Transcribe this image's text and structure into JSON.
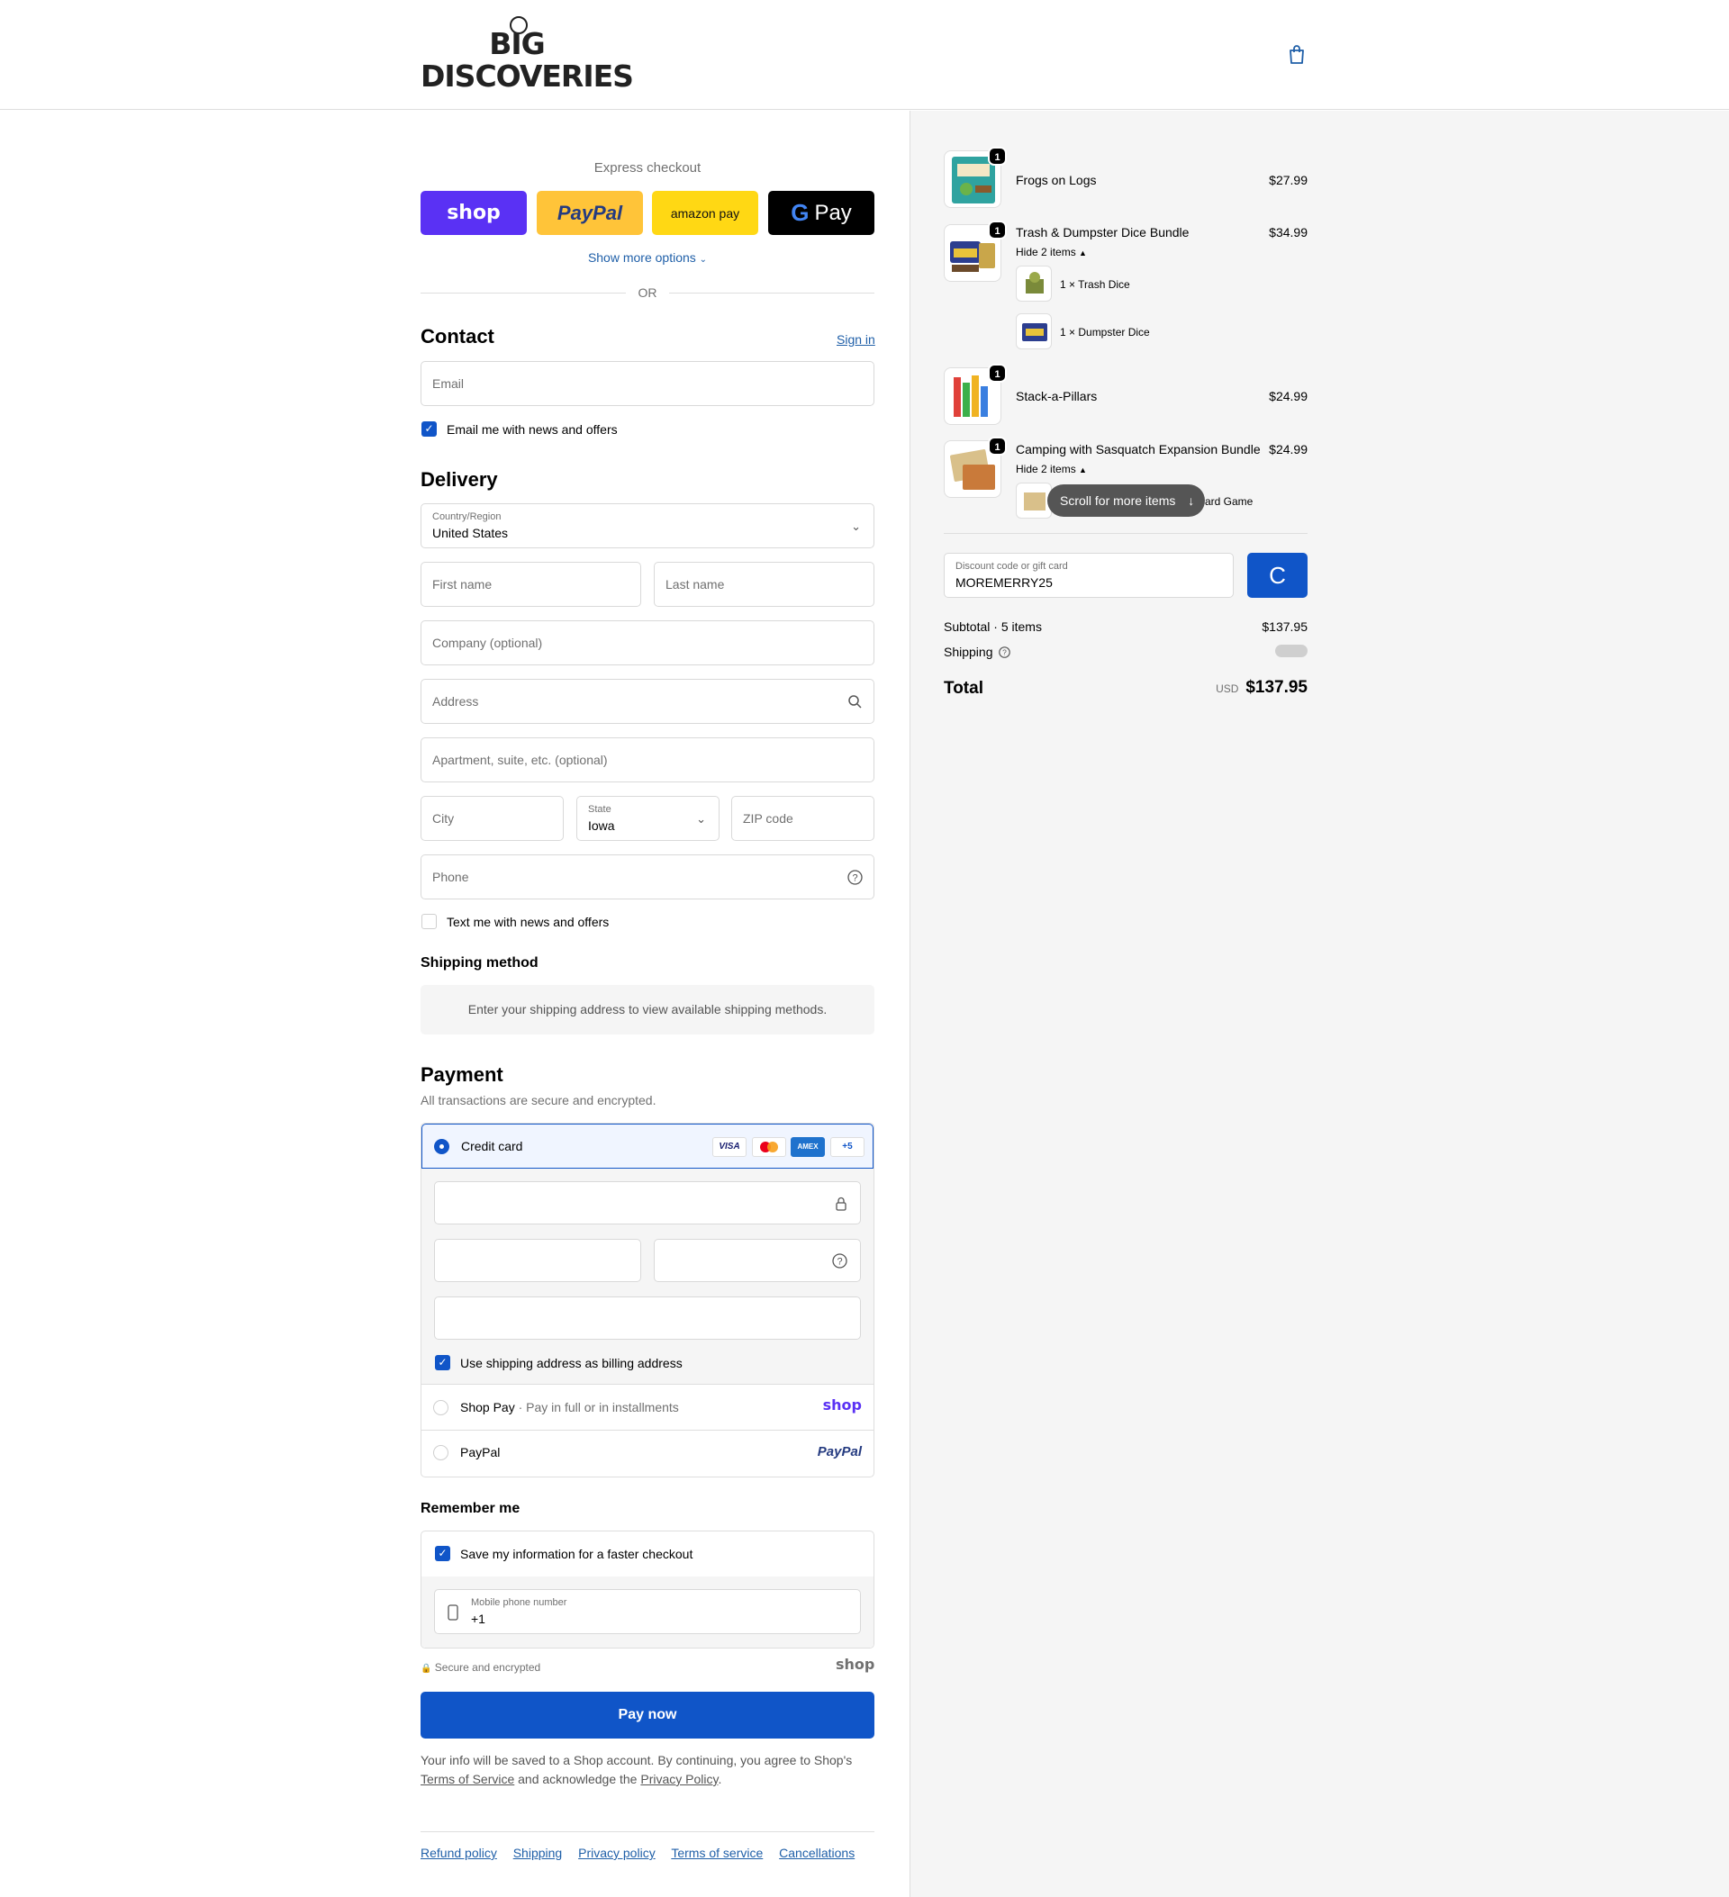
{
  "header": {
    "logo_line1": "BIG",
    "logo_line2": "DISCOVERIES"
  },
  "express": {
    "label": "Express checkout",
    "shop": "shop",
    "paypal": "PayPal",
    "amazon": "amazon pay",
    "gpay": "Pay",
    "show_more": "Show more options",
    "or": "OR"
  },
  "contact": {
    "title": "Contact",
    "sign_in": "Sign in",
    "email_placeholder": "Email",
    "email_opt_in": "Email me with news and offers"
  },
  "delivery": {
    "title": "Delivery",
    "country_label": "Country/Region",
    "country_value": "United States",
    "first_name": "First name",
    "last_name": "Last name",
    "company": "Company (optional)",
    "address": "Address",
    "apartment": "Apartment, suite, etc. (optional)",
    "city": "City",
    "state_label": "State",
    "state_value": "Iowa",
    "zip": "ZIP code",
    "phone": "Phone",
    "text_opt_in": "Text me with news and offers"
  },
  "shipping_method": {
    "title": "Shipping method",
    "message": "Enter your shipping address to view available shipping methods."
  },
  "payment": {
    "title": "Payment",
    "subtitle": "All transactions are secure and encrypted.",
    "credit_card": "Credit card",
    "cards": [
      "VISA",
      "MC",
      "AMEX",
      "+5"
    ],
    "billing_same": "Use shipping address as billing address",
    "shop_pay": "Shop Pay",
    "shop_pay_sub": "Pay in full or in installments",
    "shop_logo": "shop",
    "paypal": "PayPal",
    "paypal_logo": "PayPal"
  },
  "remember": {
    "title": "Remember me",
    "save_info": "Save my information for a faster checkout",
    "mobile_label": "Mobile phone number",
    "mobile_value": "+1",
    "secure": "Secure and encrypted",
    "shop_logo": "shop"
  },
  "pay_now": "Pay now",
  "legal": {
    "text1": "Your info will be saved to a Shop account. By continuing, you agree to Shop's",
    "terms": "Terms of Service",
    "text2": "and acknowledge the",
    "privacy": "Privacy Policy",
    "period": "."
  },
  "footer": {
    "links": [
      "Refund policy",
      "Shipping",
      "Privacy policy",
      "Terms of service",
      "Cancellations"
    ]
  },
  "order": {
    "items": [
      {
        "name": "Frogs on Logs",
        "price": "$27.99",
        "qty": "1"
      },
      {
        "name": "Trash & Dumpster Dice Bundle",
        "price": "$34.99",
        "qty": "1",
        "toggle": "Hide 2 items",
        "sub": [
          "1 × Trash Dice",
          "1 × Dumpster Dice"
        ]
      },
      {
        "name": "Stack-a-Pillars",
        "price": "$24.99",
        "qty": "1"
      },
      {
        "name": "Camping with Sasquatch Expansion Bundle",
        "price": "$24.99",
        "qty": "1",
        "toggle": "Hide 2 items",
        "sub_partial": "ard Game"
      }
    ],
    "scroll_hint": "Scroll for more items",
    "discount_label": "Discount code or gift card",
    "discount_value": "MOREMERRY25",
    "subtotal_label": "Subtotal · 5 items",
    "subtotal_value": "$137.95",
    "shipping_label": "Shipping",
    "total_label": "Total",
    "currency": "USD",
    "total_value": "$137.95"
  },
  "colors": {
    "accent": "#1055c8",
    "link": "#1f5fa8",
    "shop_purple": "#5a31f4",
    "paypal_yellow": "#ffc439",
    "amazon_yellow": "#ffd814"
  }
}
